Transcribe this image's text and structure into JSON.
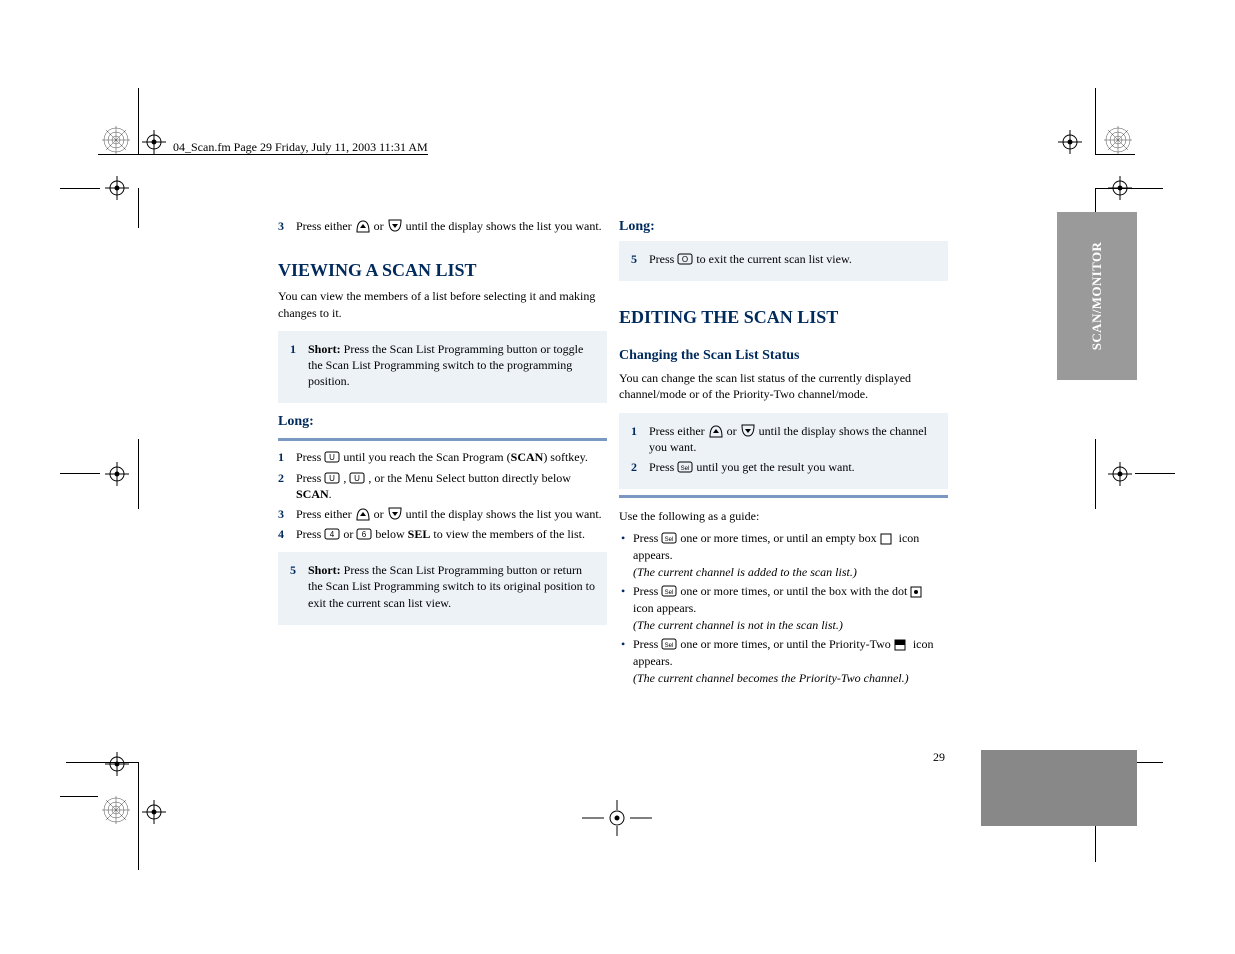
{
  "header": "04_Scan.fm  Page 29  Friday, July 11, 2003  11:31 AM",
  "side_tab": "SCAN/MONITOR",
  "col1": {
    "step_a": {
      "num": "3",
      "lead": "Press either ",
      "after_icons": " until the display shows the list you want."
    },
    "heading": "VIEWING A SCAN LIST",
    "p1": "You can view the members of a list before selecting it and making changes to it.",
    "box1_label": "Short:",
    "box1_text": "Press the Scan List Programming button or toggle the Scan List Programming switch to the programming position.",
    "long_heading": "Long:",
    "long_s1_a": "Press ",
    "long_s1_b": " until you reach the Scan Program (",
    "long_s1_c": ") softkey.",
    "long_s2_a": "Press ",
    "long_s2_b": ", ",
    "long_s2_c": ", or the Menu Select button directly below ",
    "long_s2_d": ".",
    "s3_a": "Press either ",
    "s3_b": " until the display shows the list you want.",
    "s4_a": "Press ",
    "s4_b": " or ",
    "s4_c": " below ",
    "s4_d": " to view the members of the list.",
    "box2_label": "Short:",
    "box2_text": "Press the Scan List Programming button or return the Scan List Programming switch to its original position to exit the current scan list view."
  },
  "col2": {
    "long_s5_a": "Press ",
    "long_s5_b": " to exit the current scan list view.",
    "h1": "EDITING THE SCAN LIST",
    "h2": "Changing the Scan List Status",
    "p1": "You can change the scan list status of the currently displayed channel/mode or of the Priority-Two channel/mode.",
    "s1_a": "Press either ",
    "s1_b": " until the display shows the channel you want.",
    "s2_a": "Press ",
    "s2_b": " until you get the result you want.",
    "leadin": "Use the following as a guide:",
    "b1_a": "Press ",
    "b1_b": " one or more times, or until an empty box ",
    "b1_c": " icon appears.",
    "b1_note": "(The current channel is added to the scan list.)",
    "b2_a": "Press ",
    "b2_b": " one or more times, or until the box with the dot ",
    "b2_c": " icon appears.",
    "b2_note": "(The current channel is not in the scan list.)",
    "b3_a": "Press ",
    "b3_b": " one or more times, or until the Priority-Two ",
    "b3_c": " icon appears.",
    "b3_note": "(The current channel becomes the Priority-Two channel.)"
  },
  "softkeys": {
    "scan": "SCAN",
    "sel": "SEL"
  },
  "sym": {
    "menu": "U",
    "home": "O",
    "left": "4",
    "right": "6"
  },
  "footer": {
    "page": "29"
  }
}
